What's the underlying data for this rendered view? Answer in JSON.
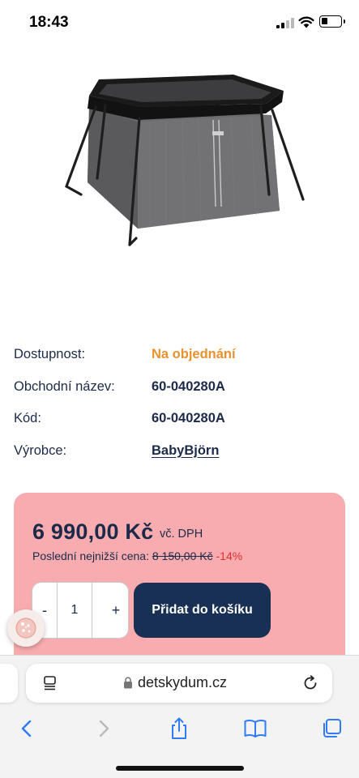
{
  "status_bar": {
    "time": "18:43",
    "icons": [
      "signal-icon",
      "wifi-icon",
      "battery-icon"
    ],
    "battery_level": 0.35
  },
  "product": {
    "image_alt": "BabyBjörn travel crib",
    "details": [
      {
        "label": "Dostupnost:",
        "value": "Na objednání"
      },
      {
        "label": "Obchodní název:",
        "value": "60-040280A"
      },
      {
        "label": "Kód:",
        "value": "60-040280A"
      },
      {
        "label": "Výrobce:",
        "value": "BabyBjörn"
      }
    ]
  },
  "price": {
    "main": "6 990,00 Kč",
    "vat_note": "vč. DPH",
    "lowest_label": "Poslední nejnižší cena:",
    "lowest_old": "8 150,00 Kč",
    "discount": "-14%"
  },
  "cart": {
    "minus_label": "-",
    "quantity": "1",
    "plus_label": "+",
    "add_to_cart_label": "Přidat do košíku"
  },
  "colors": {
    "availability": "#e8912d",
    "navy": "#1c2a4a",
    "price_box_bg": "#f9acb0",
    "button_bg": "#173054",
    "discount": "#e0302b",
    "ios_blue": "#2f7cf6"
  },
  "browser": {
    "url": "detskydum.cz",
    "icons": [
      "reader-icon",
      "lock-icon",
      "reload-icon",
      "back-icon",
      "forward-icon",
      "share-icon",
      "bookmarks-icon",
      "tabs-icon"
    ]
  }
}
